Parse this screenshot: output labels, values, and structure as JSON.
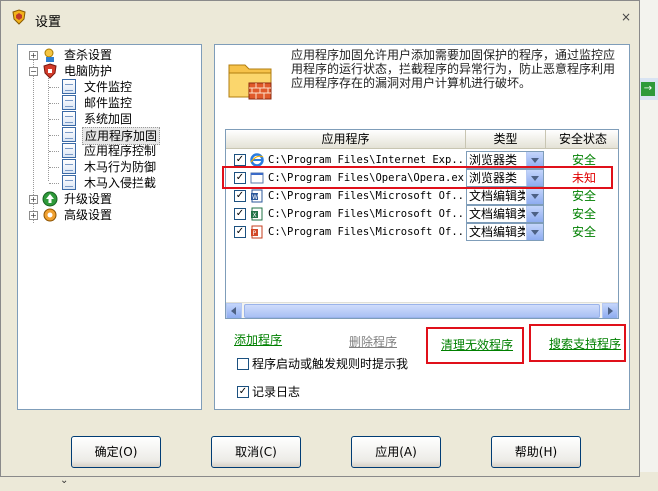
{
  "window": {
    "title": "设置",
    "close_glyph": "×"
  },
  "tree": {
    "items": [
      {
        "label": "查杀设置",
        "expander": "+",
        "icon": "scan-settings-icon"
      },
      {
        "label": "电脑防护",
        "expander": "−",
        "icon": "protection-icon"
      },
      {
        "label": "文件监控",
        "icon": "page-icon"
      },
      {
        "label": "邮件监控",
        "icon": "page-icon"
      },
      {
        "label": "系统加固",
        "icon": "page-icon"
      },
      {
        "label": "应用程序加固",
        "icon": "page-icon",
        "selected": true
      },
      {
        "label": "应用程序控制",
        "icon": "page-icon"
      },
      {
        "label": "木马行为防御",
        "icon": "page-icon"
      },
      {
        "label": "木马入侵拦截",
        "icon": "page-icon"
      },
      {
        "label": "升级设置",
        "expander": "+",
        "icon": "upgrade-icon"
      },
      {
        "label": "高级设置",
        "expander": "+",
        "icon": "advanced-gear-icon"
      }
    ]
  },
  "panel": {
    "description": "应用程序加固允许用户添加需要加固保护的程序，通过监控应用程序的运行状态，拦截程序的异常行为，防止恶意程序利用应用程序存在的漏洞对用户计算机进行破坏。",
    "columns": [
      "应用程序",
      "类型",
      "安全状态"
    ],
    "rows": [
      {
        "checked": "✓",
        "path": "C:\\Program Files\\Internet Exp...",
        "type": "浏览器类",
        "status": "安全",
        "status_color": "#008000",
        "icon": "internet-explorer-icon"
      },
      {
        "checked": "✓",
        "path": "C:\\Program Files\\Opera\\Opera.exe",
        "type": "浏览器类",
        "status": "未知",
        "status_color": "#e00000",
        "icon": "opera-app-icon"
      },
      {
        "checked": "✓",
        "path": "C:\\Program Files\\Microsoft Of...",
        "type": "文档编辑类",
        "status": "安全",
        "status_color": "#008000",
        "icon": "word-icon"
      },
      {
        "checked": "✓",
        "path": "C:\\Program Files\\Microsoft Of...",
        "type": "文档编辑类",
        "status": "安全",
        "status_color": "#008000",
        "icon": "excel-icon"
      },
      {
        "checked": "✓",
        "path": "C:\\Program Files\\Microsoft Of...",
        "type": "文档编辑类",
        "status": "安全",
        "status_color": "#008000",
        "icon": "powerpoint-icon"
      }
    ],
    "links": {
      "add": "添加程序",
      "delete": "删除程序",
      "clean": "清理无效程序",
      "search": "搜索支持程序"
    },
    "options": {
      "prompt_label": "程序启动或触发规则时提示我",
      "prompt_checked": "",
      "log_label": "记录日志",
      "log_checked": "✓"
    }
  },
  "buttons": {
    "ok": "确定(O)",
    "cancel": "取消(C)",
    "apply": "应用(A)",
    "help": "帮助(H)"
  },
  "colors": {
    "link_green": "#008000",
    "link_gray": "#808080",
    "highlight_red": "#e0101a",
    "status_safe": "#008000",
    "status_unknown": "#e00000"
  }
}
